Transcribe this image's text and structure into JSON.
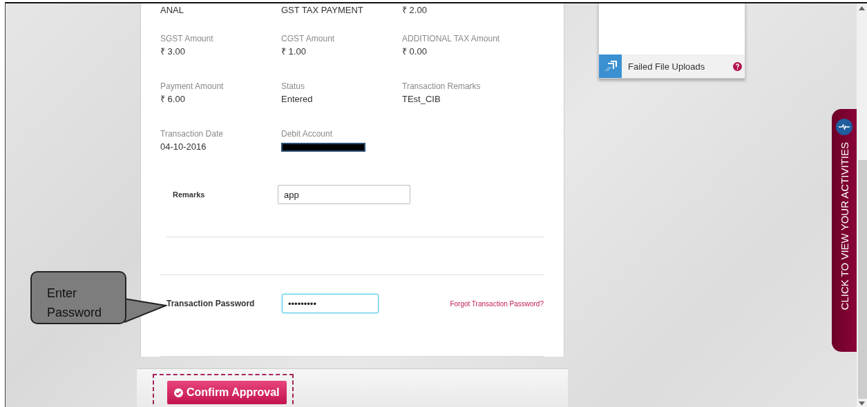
{
  "details": {
    "rows": [
      [
        {
          "value": "ANAL"
        },
        {
          "value": "GST TAX PAYMENT"
        },
        {
          "value": "₹ 2.00"
        }
      ],
      [
        {
          "label": "SGST Amount",
          "value": "₹ 3.00"
        },
        {
          "label": "CGST Amount",
          "value": "₹ 1.00"
        },
        {
          "label": "ADDITIONAL TAX Amount",
          "value": "₹ 0.00"
        }
      ],
      [
        {
          "label": "Payment Amount",
          "value": "₹ 6.00"
        },
        {
          "label": "Status",
          "value": "Entered"
        },
        {
          "label": "Transaction Remarks",
          "value": "TEst_CIB"
        }
      ],
      [
        {
          "label": "Transaction Date",
          "value": "04-10-2016"
        },
        {
          "label": "Debit Account",
          "redacted": true
        }
      ]
    ]
  },
  "remarks": {
    "label": "Remarks",
    "value": "app"
  },
  "password": {
    "label": "Transaction Password",
    "value": "•••••••••",
    "focused": true,
    "link": "Forgot Transaction Password?"
  },
  "confirm_button": {
    "label": "Confirm Approval",
    "highlighted": true
  },
  "callout": {
    "text": "Enter Password"
  },
  "side_panel": {
    "item": "Failed File Uploads"
  },
  "activities_tab": {
    "label": "CLICK TO VIEW YOUR ACTIVITIES"
  }
}
